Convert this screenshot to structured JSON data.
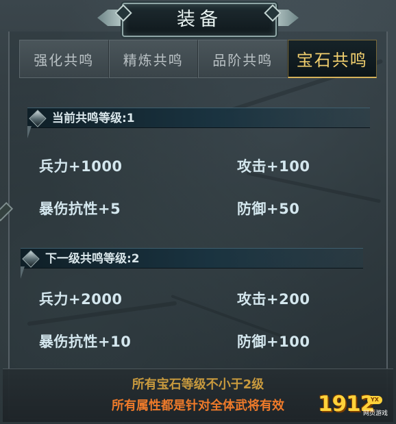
{
  "window": {
    "title": "装备"
  },
  "tabs": [
    {
      "label": "强化共鸣",
      "active": false
    },
    {
      "label": "精炼共鸣",
      "active": false
    },
    {
      "label": "品阶共鸣",
      "active": false
    },
    {
      "label": "宝石共鸣",
      "active": true
    }
  ],
  "current": {
    "header": "当前共鸣等级:1",
    "stats": [
      {
        "label": "兵力+1000"
      },
      {
        "label": "攻击+100"
      },
      {
        "label": "暴伤抗性+5"
      },
      {
        "label": "防御+50"
      }
    ]
  },
  "next": {
    "header": "下一级共鸣等级:2",
    "stats": [
      {
        "label": "兵力+2000"
      },
      {
        "label": "攻击+200"
      },
      {
        "label": "暴伤抗性+10"
      },
      {
        "label": "防御+100"
      }
    ]
  },
  "footer": {
    "requirement": "所有宝石等级不小于2级",
    "note": "所有属性都是针对全体武将有效"
  },
  "watermark": {
    "number": "1912",
    "badge": "YX",
    "sub": "网页游戏"
  },
  "colors": {
    "active_tab_text": "#f1cf6e",
    "stat_text": "#d4e7ee",
    "footer_requirement": "#c89a3e",
    "footer_note": "#ee7a2a"
  }
}
